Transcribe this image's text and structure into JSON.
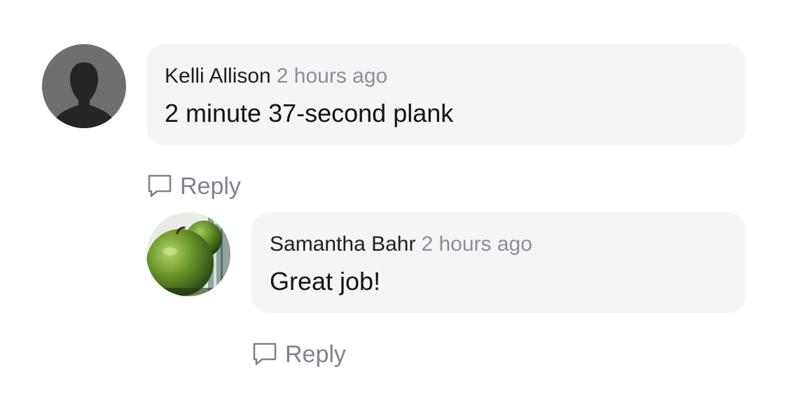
{
  "comments": [
    {
      "author": "Kelli Allison",
      "time": "2 hours ago",
      "text": "2 minute 37-second plank",
      "reply_label": "Reply",
      "avatar_icon": "default-person-silhouette"
    },
    {
      "author": "Samantha Bahr",
      "time": "2 hours ago",
      "text": "Great job!",
      "reply_label": "Reply",
      "avatar_icon": "green-apple-photo"
    }
  ],
  "colors": {
    "bubble_bg": "#f4f5f7",
    "author_text": "#1c1e21",
    "meta_text": "#8a8f98",
    "reply_text": "#7d8390",
    "avatar_placeholder_bg": "#6f6f6f"
  }
}
